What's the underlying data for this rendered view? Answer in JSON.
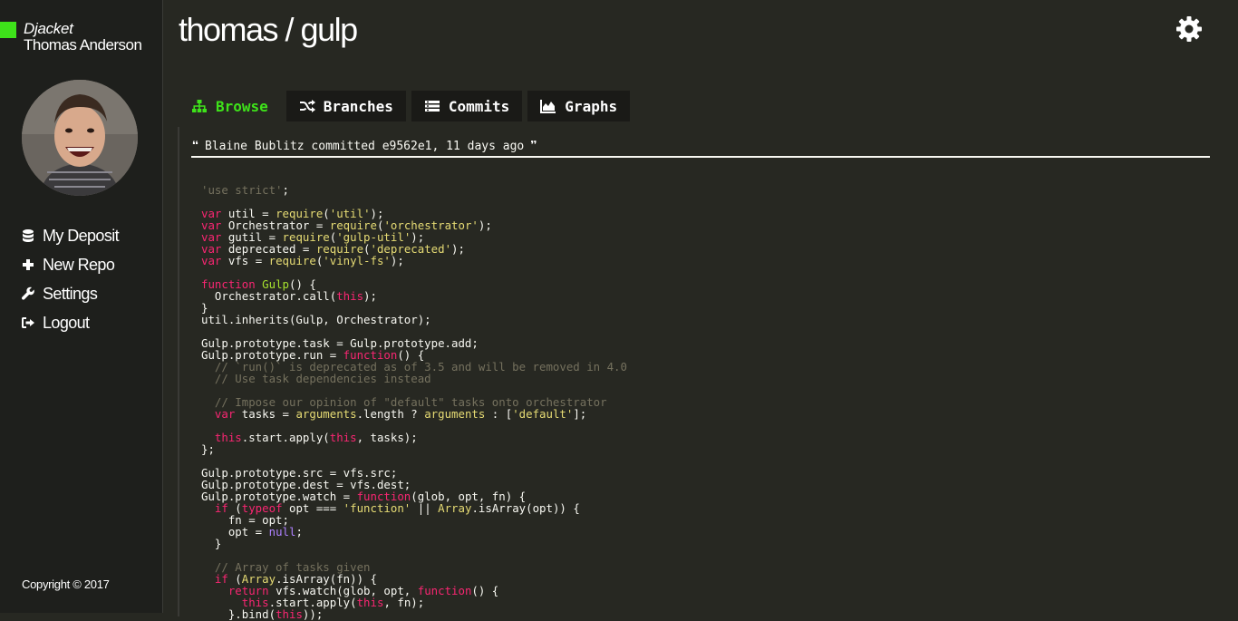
{
  "app": {
    "brand": "Djacket",
    "user": "Thomas Anderson",
    "copyright": "Copyright © 2017",
    "accent": "#3ee21a"
  },
  "nav": [
    {
      "label": "My Deposit",
      "icon": "database-icon"
    },
    {
      "label": "New Repo",
      "icon": "plus-icon"
    },
    {
      "label": "Settings",
      "icon": "wrench-icon"
    },
    {
      "label": "Logout",
      "icon": "logout-icon"
    }
  ],
  "page": {
    "title": "thomas / gulp",
    "settings_icon": "gear-icon"
  },
  "tabs": [
    {
      "label": "Browse",
      "icon": "sitemap-icon",
      "active": true
    },
    {
      "label": "Branches",
      "icon": "shuffle-icon",
      "active": false
    },
    {
      "label": "Commits",
      "icon": "list-icon",
      "active": false
    },
    {
      "label": "Graphs",
      "icon": "area-chart-icon",
      "active": false
    }
  ],
  "commit": {
    "text": "Blaine Bublitz committed e9562e1, 11 days ago"
  },
  "code": {
    "language": "javascript",
    "lines": [
      "'use strict';",
      "",
      "var util = require('util');",
      "var Orchestrator = require('orchestrator');",
      "var gutil = require('gulp-util');",
      "var deprecated = require('deprecated');",
      "var vfs = require('vinyl-fs');",
      "",
      "function Gulp() {",
      "  Orchestrator.call(this);",
      "}",
      "util.inherits(Gulp, Orchestrator);",
      "",
      "Gulp.prototype.task = Gulp.prototype.add;",
      "Gulp.prototype.run = function() {",
      "  // `run()` is deprecated as of 3.5 and will be removed in 4.0",
      "  // Use task dependencies instead",
      "",
      "  // Impose our opinion of \"default\" tasks onto orchestrator",
      "  var tasks = arguments.length ? arguments : ['default'];",
      "",
      "  this.start.apply(this, tasks);",
      "};",
      "",
      "Gulp.prototype.src = vfs.src;",
      "Gulp.prototype.dest = vfs.dest;",
      "Gulp.prototype.watch = function(glob, opt, fn) {",
      "  if (typeof opt === 'function' || Array.isArray(opt)) {",
      "    fn = opt;",
      "    opt = null;",
      "  }",
      "",
      "  // Array of tasks given",
      "  if (Array.isArray(fn)) {",
      "    return vfs.watch(glob, opt, function() {",
      "      this.start.apply(this, fn);",
      "    }.bind(this));"
    ]
  }
}
